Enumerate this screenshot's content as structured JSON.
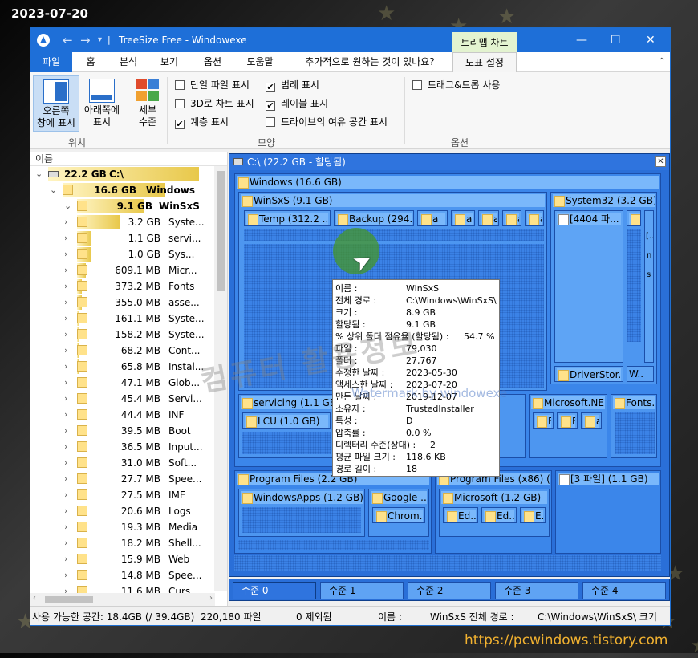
{
  "date_stamp": "2023-07-20",
  "site_url": "https://pcwindows.tistory.com",
  "watermark": "컴퓨터 활용정보",
  "watermark_small": "Watermark by windowexe",
  "window": {
    "title": "TreeSize Free  - Windowexe",
    "context_tab": "트리맵 차트"
  },
  "menu_tabs": [
    "파일",
    "홈",
    "분석",
    "보기",
    "옵션",
    "도움말",
    "추가적으로 원하는 것이 있나요?",
    "도표 설정"
  ],
  "ribbon": {
    "right_pane": "오른쪽\n창에 표시",
    "right_pane_l1": "오른쪽",
    "right_pane_l2": "창에 표시",
    "bottom_pane_l1": "아래쪽에",
    "bottom_pane_l2": "표시",
    "detail_l1": "세부",
    "detail_l2": "수준",
    "checks": {
      "single_file": "단일 파일 표시",
      "chart_3d": "3D로 차트 표시",
      "hierarchy": "계층 표시",
      "legend": "범례 표시",
      "labels": "레이블 표시",
      "free_space": "드라이브의 여유 공간 표시",
      "drag_drop": "드래그&드롭 사용"
    },
    "groups": {
      "position": "위치",
      "shape": "모양",
      "options": "옵션"
    }
  },
  "tree": {
    "column_header": "이름",
    "rows": [
      {
        "size": "22.2 GB",
        "name": "C:\\",
        "bar": 1.0
      },
      {
        "size": "16.6 GB",
        "name": "Windows",
        "bar": 0.75
      },
      {
        "size": "9.1 GB",
        "name": "WinSxS",
        "bar": 0.55
      },
      {
        "size": "3.2 GB",
        "name": "Syste...",
        "bar": 0.35
      },
      {
        "size": "1.1 GB",
        "name": "servi...",
        "bar": 0.12
      },
      {
        "size": "1.0 GB",
        "name": "Sys...",
        "bar": 0.11
      },
      {
        "size": "609.1 MB",
        "name": "Micr...",
        "bar": 0.07
      },
      {
        "size": "373.2 MB",
        "name": "Fonts",
        "bar": 0.04
      },
      {
        "size": "355.0 MB",
        "name": "asse...",
        "bar": 0.04
      },
      {
        "size": "161.1 MB",
        "name": "Syste...",
        "bar": 0.02
      },
      {
        "size": "158.2 MB",
        "name": "Syste...",
        "bar": 0.02
      },
      {
        "size": "68.2 MB",
        "name": "Cont...",
        "bar": 0.01
      },
      {
        "size": "65.8 MB",
        "name": "Instal...",
        "bar": 0.01
      },
      {
        "size": "47.1 MB",
        "name": "Glob...",
        "bar": 0.0
      },
      {
        "size": "45.4 MB",
        "name": "Servi...",
        "bar": 0.0
      },
      {
        "size": "44.4 MB",
        "name": "INF",
        "bar": 0.0
      },
      {
        "size": "39.5 MB",
        "name": "Boot",
        "bar": 0.0
      },
      {
        "size": "36.5 MB",
        "name": "Input...",
        "bar": 0.0
      },
      {
        "size": "31.0 MB",
        "name": "Soft...",
        "bar": 0.0
      },
      {
        "size": "27.7 MB",
        "name": "Spee...",
        "bar": 0.0
      },
      {
        "size": "27.5 MB",
        "name": "IME",
        "bar": 0.0
      },
      {
        "size": "20.6 MB",
        "name": "Logs",
        "bar": 0.0
      },
      {
        "size": "19.3 MB",
        "name": "Media",
        "bar": 0.0
      },
      {
        "size": "18.2 MB",
        "name": "Shell...",
        "bar": 0.0
      },
      {
        "size": "15.9 MB",
        "name": "Web",
        "bar": 0.0
      },
      {
        "size": "14.8 MB",
        "name": "Spee...",
        "bar": 0.0
      },
      {
        "size": "11.6 MB",
        "name": "Curs...",
        "bar": 0.0
      }
    ]
  },
  "treemap": {
    "header": "C:\\ (22.2 GB - 할당됨)",
    "labels": {
      "windows": "Windows (16.6 GB)",
      "winsxs": "WinSxS (9.1 GB)",
      "temp": "Temp (312.2 ...",
      "backup": "Backup (294....",
      "a": "a",
      "system32": "System32 (3.2 GB)",
      "files4404": "[4404 파...",
      "bracket": "[..",
      "n": "n",
      "s": "s",
      "driverstore": "DriverStor...",
      "w": "W..",
      "servicing": "servicing (1.1 GB)",
      "lcu": "LCU (1.0 GB)",
      "gb": "B)",
      "msnet": "Microsoft.NE...",
      "fonts": "Fonts...",
      "f1": "F..",
      "f2": "F..",
      "program_files": "Program Files (2.2 GB)",
      "program_files_x86": "Program Files (x86) (1....",
      "files3": "[3 파일] (1.1 GB)",
      "windowsapps": "WindowsApps (1.2 GB)",
      "google": "Google ...",
      "chrome": "Chrom...",
      "microsoft": "Microsoft (1.2 GB)",
      "ed1": "Ed...",
      "ed2": "Ed...",
      "e": "E..."
    }
  },
  "levels": [
    "수준 0",
    "수준 1",
    "수준 2",
    "수준 3",
    "수준 4"
  ],
  "tooltip": [
    {
      "k": "이름 :",
      "v": "WinSxS"
    },
    {
      "k": "전체 경로 :",
      "v": "C:\\Windows\\WinSxS\\"
    },
    {
      "k": "크기 :",
      "v": "8.9 GB"
    },
    {
      "k": "할당됨 :",
      "v": "9.1 GB"
    },
    {
      "k": "% 상위 폴더 점유율 (할당됨) :",
      "v": "54.7 %"
    },
    {
      "k": "파일 :",
      "v": "79,030"
    },
    {
      "k": "폴더 :",
      "v": "27,767"
    },
    {
      "k": "수정한 날짜 :",
      "v": "2023-05-30"
    },
    {
      "k": "액세스한 날짜 :",
      "v": "2023-07-20"
    },
    {
      "k": "만든 날짜 :",
      "v": "2019-12-07"
    },
    {
      "k": "소유자 :",
      "v": "TrustedInstaller"
    },
    {
      "k": "특성 :",
      "v": "D"
    },
    {
      "k": "압축률 :",
      "v": "0.0 %"
    },
    {
      "k": "디렉터리 수준(상대) :",
      "v": "2"
    },
    {
      "k": "평균 파일 크기 :",
      "v": "118.6 KB"
    },
    {
      "k": "경로 길이 :",
      "v": "18"
    }
  ],
  "status": {
    "free": "사용 가능한 공간: 18.4GB  (/ 39.4GB)",
    "files": "220,180 파일",
    "excluded": "0 제외됨",
    "name_label": "이름 :",
    "name_value": "WinSxS 전체 경로 :",
    "path_value": "C:\\Windows\\WinSxS\\ 크기"
  },
  "colors": {
    "titlebar": "#1e6fd8",
    "treemap": "#2a6fd8",
    "accent_green": "#e3f3d0"
  }
}
